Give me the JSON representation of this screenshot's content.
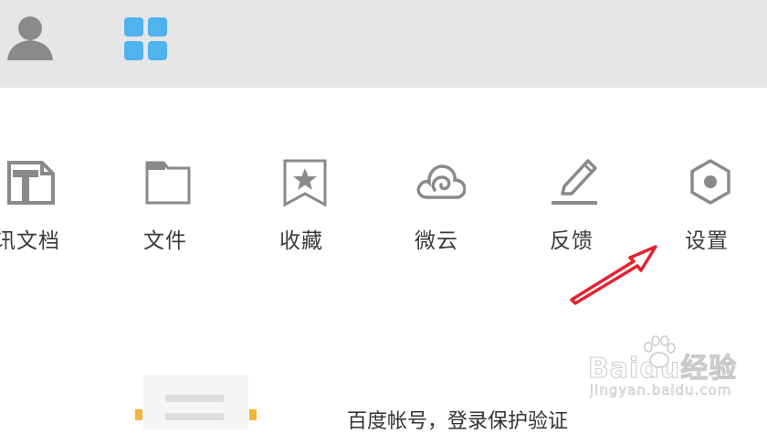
{
  "toolbar": {
    "items": [
      {
        "label": "讯文档",
        "icon": "document-edit-icon"
      },
      {
        "label": "文件",
        "icon": "folder-icon"
      },
      {
        "label": "收藏",
        "icon": "bookmark-star-icon"
      },
      {
        "label": "微云",
        "icon": "cloud-icon"
      },
      {
        "label": "反馈",
        "icon": "pencil-icon"
      },
      {
        "label": "设置",
        "icon": "hexagon-settings-icon"
      }
    ]
  },
  "card": {
    "text": "百度帐号，登录保护验证"
  },
  "watermark": {
    "logo": "Baidu经验",
    "url": "jingyan.baidu.com"
  },
  "colors": {
    "topbar": "#e6e6e6",
    "apps_icon": "#4fb3ef",
    "icon_gray": "#8a8a8a",
    "arrow_red": "#e52330",
    "card_accent": "#f5b43a"
  }
}
